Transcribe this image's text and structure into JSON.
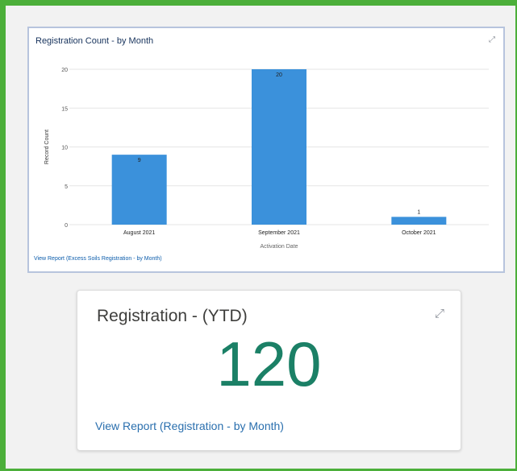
{
  "chart_card": {
    "title": "Registration Count - by Month",
    "expand_icon": "expand-icon",
    "view_report_label": "View Report (Excess Soils Registration - by Month)"
  },
  "chart_data": {
    "type": "bar",
    "title": "Registration Count - by Month",
    "categories": [
      "August 2021",
      "September 2021",
      "October 2021"
    ],
    "values": [
      9,
      20,
      1
    ],
    "xlabel": "Activation Date",
    "ylabel": "Record Count",
    "ylim": [
      0,
      20
    ],
    "yticks": [
      0,
      5,
      10,
      15,
      20
    ],
    "grid": true,
    "bar_color": "#3b91db"
  },
  "kpi_card": {
    "title": "Registration - (YTD)",
    "value": "120",
    "link_label": "View Report (Registration - by Month)",
    "expand_icon": "expand-icon",
    "value_color": "#1b8066"
  },
  "colors": {
    "frame": "#4caf3a",
    "card_border": "#b7c4dd"
  }
}
